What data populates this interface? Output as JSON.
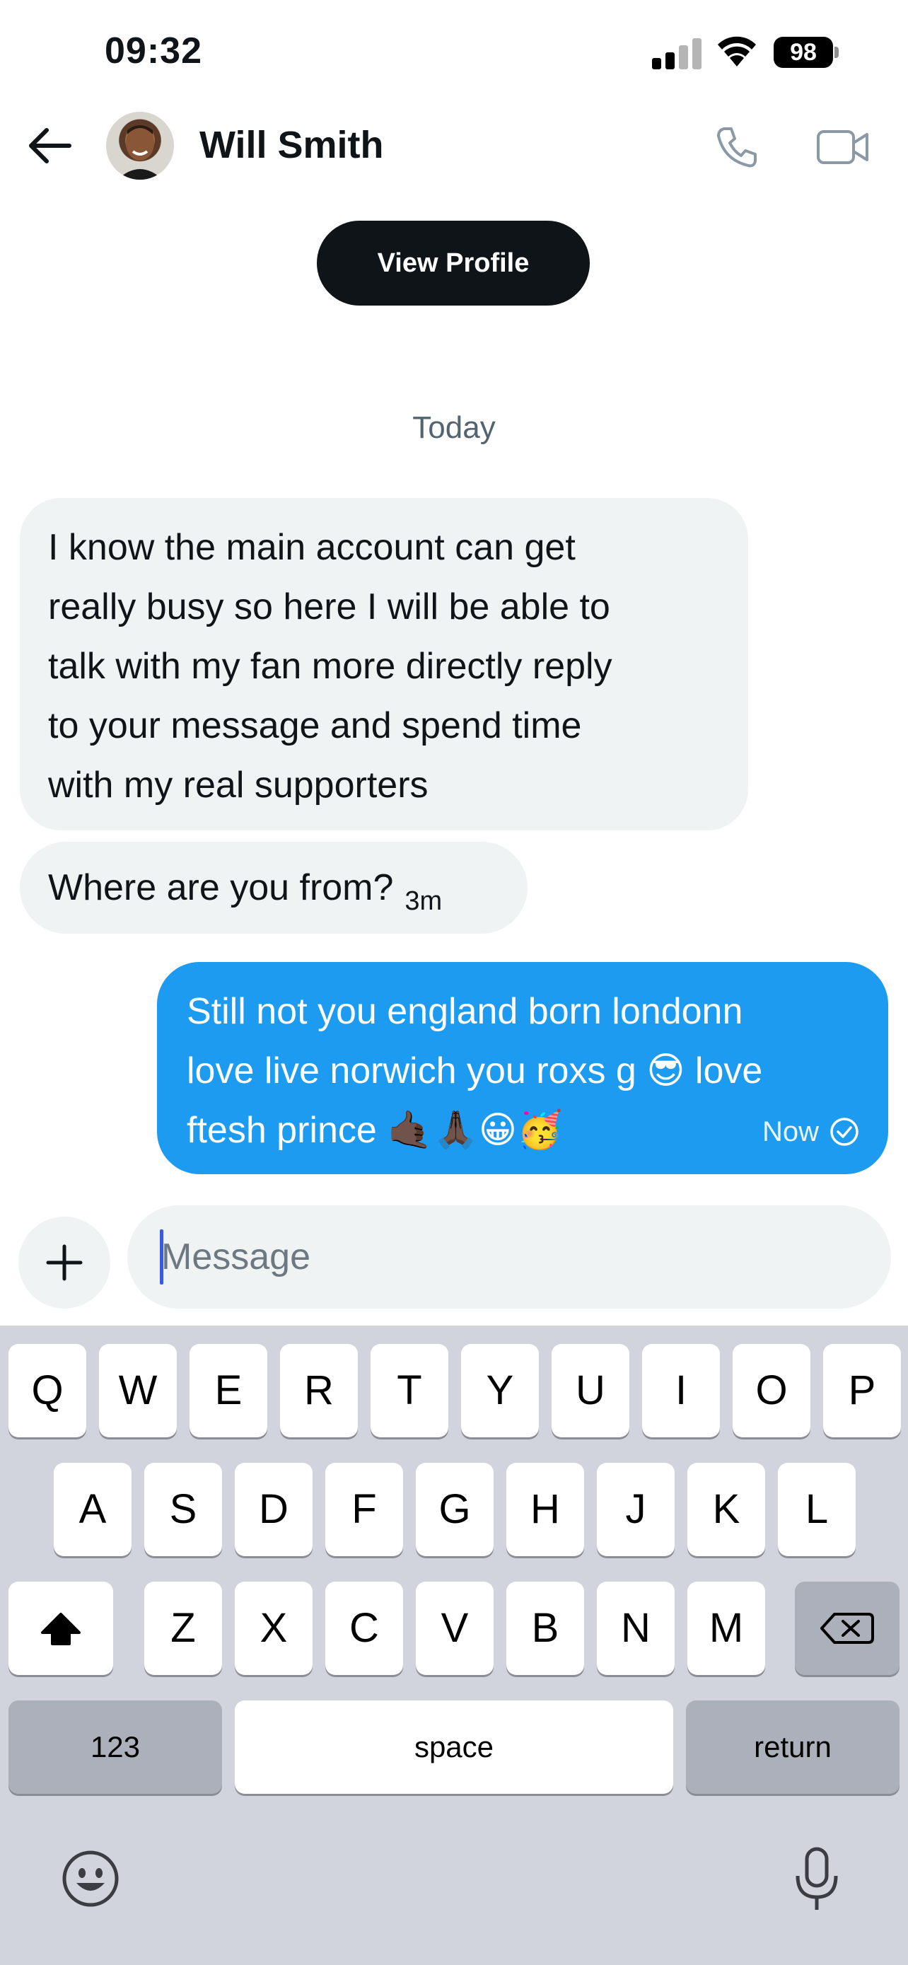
{
  "status_bar": {
    "time": "09:32",
    "battery": "98"
  },
  "header": {
    "contact_name": "Will Smith",
    "view_profile_label": "View Profile"
  },
  "date_separator": "Today",
  "messages": [
    {
      "lines": [
        "I know the main account can get",
        "really busy so here I will be able to",
        "talk with my fan more directly reply",
        "to your message and spend time",
        "with my real supporters"
      ]
    },
    {
      "text": "Where are you from?",
      "time": "3m"
    },
    {
      "lines": [
        "Still not you england born londonn",
        "love live norwich you roxs g 😎 love",
        "ftesh prince 🤙🏿🙏🏿😀🥳"
      ],
      "status": "Now"
    }
  ],
  "composer": {
    "placeholder": "Message"
  },
  "keyboard": {
    "row1": [
      "Q",
      "W",
      "E",
      "R",
      "T",
      "Y",
      "U",
      "I",
      "O",
      "P"
    ],
    "row2": [
      "A",
      "S",
      "D",
      "F",
      "G",
      "H",
      "J",
      "K",
      "L"
    ],
    "row3": [
      "Z",
      "X",
      "C",
      "V",
      "B",
      "N",
      "M"
    ],
    "numbers_label": "123",
    "space_label": "space",
    "return_label": "return"
  },
  "icons": [
    "signal-icon",
    "wifi-icon",
    "battery-icon",
    "back-arrow-icon",
    "avatar",
    "phone-icon",
    "video-icon",
    "plus-icon",
    "check-icon",
    "shift-icon",
    "backspace-icon",
    "emoji-icon",
    "microphone-icon"
  ]
}
